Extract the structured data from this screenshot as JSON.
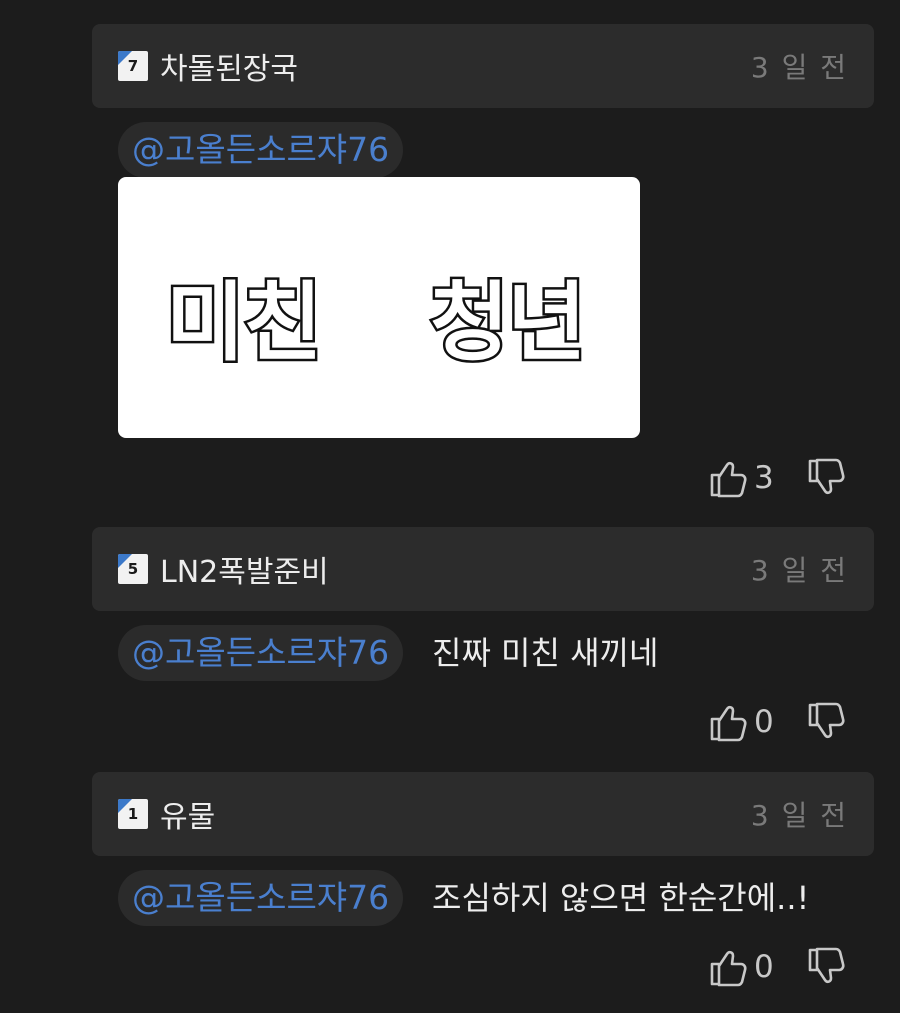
{
  "comments": [
    {
      "level": "7",
      "username": "차돌된장국",
      "time": "3 일 전",
      "mention": "@고올든소르쟈76",
      "text": "",
      "sticker": {
        "word_left": "미친",
        "word_right": "청년"
      },
      "likes": "3"
    },
    {
      "level": "5",
      "username": "LN2폭발준비",
      "time": "3 일 전",
      "mention": "@고올든소르쟈76",
      "text": "진짜 미친 새끼네",
      "likes": "0"
    },
    {
      "level": "1",
      "username": "유물",
      "time": "3 일 전",
      "mention": "@고올든소르쟈76",
      "text": "조심하지 않으면 한순간에..!",
      "likes": "0"
    }
  ],
  "icons": {
    "like": "thumbs-up-icon",
    "dislike": "thumbs-down-icon",
    "badge": "level-badge-icon"
  },
  "colors": {
    "background": "#1c1c1c",
    "header": "#2c2c2c",
    "mention": "#4a7fce",
    "badge_accent": "#3c79c9"
  }
}
